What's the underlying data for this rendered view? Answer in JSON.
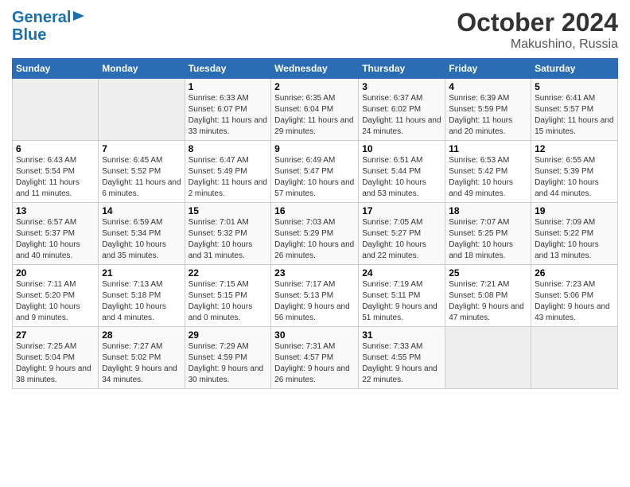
{
  "header": {
    "logo_line1": "General",
    "logo_line2": "Blue",
    "month": "October 2024",
    "location": "Makushino, Russia"
  },
  "weekdays": [
    "Sunday",
    "Monday",
    "Tuesday",
    "Wednesday",
    "Thursday",
    "Friday",
    "Saturday"
  ],
  "weeks": [
    [
      {
        "day": "",
        "empty": true
      },
      {
        "day": "",
        "empty": true
      },
      {
        "day": "1",
        "sunrise": "6:33 AM",
        "sunset": "6:07 PM",
        "daylight": "11 hours and 33 minutes."
      },
      {
        "day": "2",
        "sunrise": "6:35 AM",
        "sunset": "6:04 PM",
        "daylight": "11 hours and 29 minutes."
      },
      {
        "day": "3",
        "sunrise": "6:37 AM",
        "sunset": "6:02 PM",
        "daylight": "11 hours and 24 minutes."
      },
      {
        "day": "4",
        "sunrise": "6:39 AM",
        "sunset": "5:59 PM",
        "daylight": "11 hours and 20 minutes."
      },
      {
        "day": "5",
        "sunrise": "6:41 AM",
        "sunset": "5:57 PM",
        "daylight": "11 hours and 15 minutes."
      }
    ],
    [
      {
        "day": "6",
        "sunrise": "6:43 AM",
        "sunset": "5:54 PM",
        "daylight": "11 hours and 11 minutes."
      },
      {
        "day": "7",
        "sunrise": "6:45 AM",
        "sunset": "5:52 PM",
        "daylight": "11 hours and 6 minutes."
      },
      {
        "day": "8",
        "sunrise": "6:47 AM",
        "sunset": "5:49 PM",
        "daylight": "11 hours and 2 minutes."
      },
      {
        "day": "9",
        "sunrise": "6:49 AM",
        "sunset": "5:47 PM",
        "daylight": "10 hours and 57 minutes."
      },
      {
        "day": "10",
        "sunrise": "6:51 AM",
        "sunset": "5:44 PM",
        "daylight": "10 hours and 53 minutes."
      },
      {
        "day": "11",
        "sunrise": "6:53 AM",
        "sunset": "5:42 PM",
        "daylight": "10 hours and 49 minutes."
      },
      {
        "day": "12",
        "sunrise": "6:55 AM",
        "sunset": "5:39 PM",
        "daylight": "10 hours and 44 minutes."
      }
    ],
    [
      {
        "day": "13",
        "sunrise": "6:57 AM",
        "sunset": "5:37 PM",
        "daylight": "10 hours and 40 minutes."
      },
      {
        "day": "14",
        "sunrise": "6:59 AM",
        "sunset": "5:34 PM",
        "daylight": "10 hours and 35 minutes."
      },
      {
        "day": "15",
        "sunrise": "7:01 AM",
        "sunset": "5:32 PM",
        "daylight": "10 hours and 31 minutes."
      },
      {
        "day": "16",
        "sunrise": "7:03 AM",
        "sunset": "5:29 PM",
        "daylight": "10 hours and 26 minutes."
      },
      {
        "day": "17",
        "sunrise": "7:05 AM",
        "sunset": "5:27 PM",
        "daylight": "10 hours and 22 minutes."
      },
      {
        "day": "18",
        "sunrise": "7:07 AM",
        "sunset": "5:25 PM",
        "daylight": "10 hours and 18 minutes."
      },
      {
        "day": "19",
        "sunrise": "7:09 AM",
        "sunset": "5:22 PM",
        "daylight": "10 hours and 13 minutes."
      }
    ],
    [
      {
        "day": "20",
        "sunrise": "7:11 AM",
        "sunset": "5:20 PM",
        "daylight": "10 hours and 9 minutes."
      },
      {
        "day": "21",
        "sunrise": "7:13 AM",
        "sunset": "5:18 PM",
        "daylight": "10 hours and 4 minutes."
      },
      {
        "day": "22",
        "sunrise": "7:15 AM",
        "sunset": "5:15 PM",
        "daylight": "10 hours and 0 minutes."
      },
      {
        "day": "23",
        "sunrise": "7:17 AM",
        "sunset": "5:13 PM",
        "daylight": "9 hours and 56 minutes."
      },
      {
        "day": "24",
        "sunrise": "7:19 AM",
        "sunset": "5:11 PM",
        "daylight": "9 hours and 51 minutes."
      },
      {
        "day": "25",
        "sunrise": "7:21 AM",
        "sunset": "5:08 PM",
        "daylight": "9 hours and 47 minutes."
      },
      {
        "day": "26",
        "sunrise": "7:23 AM",
        "sunset": "5:06 PM",
        "daylight": "9 hours and 43 minutes."
      }
    ],
    [
      {
        "day": "27",
        "sunrise": "7:25 AM",
        "sunset": "5:04 PM",
        "daylight": "9 hours and 38 minutes."
      },
      {
        "day": "28",
        "sunrise": "7:27 AM",
        "sunset": "5:02 PM",
        "daylight": "9 hours and 34 minutes."
      },
      {
        "day": "29",
        "sunrise": "7:29 AM",
        "sunset": "4:59 PM",
        "daylight": "9 hours and 30 minutes."
      },
      {
        "day": "30",
        "sunrise": "7:31 AM",
        "sunset": "4:57 PM",
        "daylight": "9 hours and 26 minutes."
      },
      {
        "day": "31",
        "sunrise": "7:33 AM",
        "sunset": "4:55 PM",
        "daylight": "9 hours and 22 minutes."
      },
      {
        "day": "",
        "empty": true
      },
      {
        "day": "",
        "empty": true
      }
    ]
  ]
}
